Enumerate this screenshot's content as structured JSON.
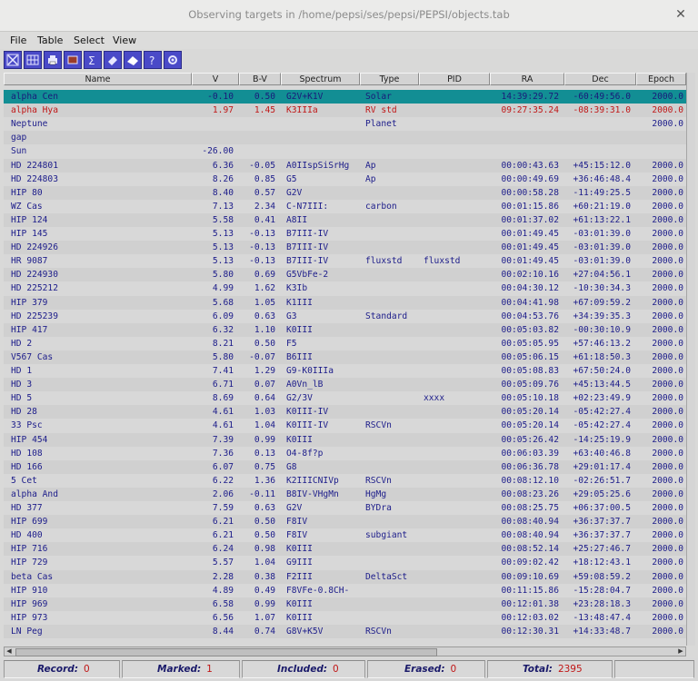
{
  "window": {
    "title": "Observing targets in /home/pepsi/ses/pepsi/PEPSI/objects.tab"
  },
  "menu": [
    "File",
    "Table",
    "Select",
    "View"
  ],
  "toolbar_icons": [
    "select-all-icon",
    "columns-icon",
    "print-icon",
    "cut-icon",
    "sum-icon",
    "tag-icon",
    "erase-icon",
    "help-icon",
    "settings-icon"
  ],
  "colors": {
    "selected_row": "#128e94",
    "text": "#1c1c8a",
    "highlight_red": "#c01616",
    "toolbar_button": "#4a4ac8"
  },
  "columns": [
    "Name",
    "V",
    "B-V",
    "Spectrum",
    "Type",
    "PID",
    "RA",
    "Dec",
    "Epoch"
  ],
  "rows": [
    {
      "name": "alpha Cen",
      "v": "-0.10",
      "bv": "0.50",
      "spectrum": "G2V+K1V",
      "type": "Solar",
      "pid": "",
      "ra": "14:39:29.72",
      "dec": "-60:49:56.0",
      "epoch": "2000.0",
      "state": "selected"
    },
    {
      "name": "alpha Hya",
      "v": "1.97",
      "bv": "1.45",
      "spectrum": "K3IIIa",
      "type": "RV std",
      "pid": "",
      "ra": "09:27:35.24",
      "dec": "-08:39:31.0",
      "epoch": "2000.0",
      "state": "red"
    },
    {
      "name": "Neptune",
      "v": "",
      "bv": "",
      "spectrum": "",
      "type": "Planet",
      "pid": "",
      "ra": "",
      "dec": "",
      "epoch": "2000.0"
    },
    {
      "name": "gap",
      "v": "",
      "bv": "",
      "spectrum": "",
      "type": "",
      "pid": "",
      "ra": "",
      "dec": "",
      "epoch": ""
    },
    {
      "name": "Sun",
      "v": "-26.00",
      "bv": "",
      "spectrum": "",
      "type": "",
      "pid": "",
      "ra": "",
      "dec": "",
      "epoch": ""
    },
    {
      "name": "HD 224801",
      "v": "6.36",
      "bv": "-0.05",
      "spectrum": "A0IIspSiSrHg",
      "type": "Ap",
      "pid": "",
      "ra": "00:00:43.63",
      "dec": "+45:15:12.0",
      "epoch": "2000.0"
    },
    {
      "name": "HD 224803",
      "v": "8.26",
      "bv": "0.85",
      "spectrum": "G5",
      "type": "Ap",
      "pid": "",
      "ra": "00:00:49.69",
      "dec": "+36:46:48.4",
      "epoch": "2000.0"
    },
    {
      "name": "HIP 80",
      "v": "8.40",
      "bv": "0.57",
      "spectrum": "G2V",
      "type": "",
      "pid": "",
      "ra": "00:00:58.28",
      "dec": "-11:49:25.5",
      "epoch": "2000.0"
    },
    {
      "name": "WZ Cas",
      "v": "7.13",
      "bv": "2.34",
      "spectrum": "C-N7III:",
      "type": "carbon",
      "pid": "",
      "ra": "00:01:15.86",
      "dec": "+60:21:19.0",
      "epoch": "2000.0"
    },
    {
      "name": "HIP 124",
      "v": "5.58",
      "bv": "0.41",
      "spectrum": "A8II",
      "type": "",
      "pid": "",
      "ra": "00:01:37.02",
      "dec": "+61:13:22.1",
      "epoch": "2000.0"
    },
    {
      "name": "HIP 145",
      "v": "5.13",
      "bv": "-0.13",
      "spectrum": "B7III-IV",
      "type": "",
      "pid": "",
      "ra": "00:01:49.45",
      "dec": "-03:01:39.0",
      "epoch": "2000.0"
    },
    {
      "name": "HD 224926",
      "v": "5.13",
      "bv": "-0.13",
      "spectrum": "B7III-IV",
      "type": "",
      "pid": "",
      "ra": "00:01:49.45",
      "dec": "-03:01:39.0",
      "epoch": "2000.0"
    },
    {
      "name": "HR 9087",
      "v": "5.13",
      "bv": "-0.13",
      "spectrum": "B7III-IV",
      "type": "fluxstd",
      "pid": "fluxstd",
      "ra": "00:01:49.45",
      "dec": "-03:01:39.0",
      "epoch": "2000.0"
    },
    {
      "name": "HD 224930",
      "v": "5.80",
      "bv": "0.69",
      "spectrum": "G5VbFe-2",
      "type": "",
      "pid": "",
      "ra": "00:02:10.16",
      "dec": "+27:04:56.1",
      "epoch": "2000.0"
    },
    {
      "name": "HD 225212",
      "v": "4.99",
      "bv": "1.62",
      "spectrum": "K3Ib",
      "type": "",
      "pid": "",
      "ra": "00:04:30.12",
      "dec": "-10:30:34.3",
      "epoch": "2000.0"
    },
    {
      "name": "HIP 379",
      "v": "5.68",
      "bv": "1.05",
      "spectrum": "K1III",
      "type": "",
      "pid": "",
      "ra": "00:04:41.98",
      "dec": "+67:09:59.2",
      "epoch": "2000.0"
    },
    {
      "name": "HD 225239",
      "v": "6.09",
      "bv": "0.63",
      "spectrum": "G3",
      "type": "Standard",
      "pid": "",
      "ra": "00:04:53.76",
      "dec": "+34:39:35.3",
      "epoch": "2000.0"
    },
    {
      "name": "HIP 417",
      "v": "6.32",
      "bv": "1.10",
      "spectrum": "K0III",
      "type": "",
      "pid": "",
      "ra": "00:05:03.82",
      "dec": "-00:30:10.9",
      "epoch": "2000.0"
    },
    {
      "name": "HD 2",
      "v": "8.21",
      "bv": "0.50",
      "spectrum": "F5",
      "type": "",
      "pid": "",
      "ra": "00:05:05.95",
      "dec": "+57:46:13.2",
      "epoch": "2000.0"
    },
    {
      "name": "V567 Cas",
      "v": "5.80",
      "bv": "-0.07",
      "spectrum": "B6III",
      "type": "",
      "pid": "",
      "ra": "00:05:06.15",
      "dec": "+61:18:50.3",
      "epoch": "2000.0"
    },
    {
      "name": "HD 1",
      "v": "7.41",
      "bv": "1.29",
      "spectrum": "G9-K0IIIa",
      "type": "",
      "pid": "",
      "ra": "00:05:08.83",
      "dec": "+67:50:24.0",
      "epoch": "2000.0"
    },
    {
      "name": "HD 3",
      "v": "6.71",
      "bv": "0.07",
      "spectrum": "A0Vn_lB",
      "type": "",
      "pid": "",
      "ra": "00:05:09.76",
      "dec": "+45:13:44.5",
      "epoch": "2000.0"
    },
    {
      "name": "HD 5",
      "v": "8.69",
      "bv": "0.64",
      "spectrum": "G2/3V",
      "type": "",
      "pid": "xxxx",
      "ra": "00:05:10.18",
      "dec": "+02:23:49.9",
      "epoch": "2000.0"
    },
    {
      "name": "HD 28",
      "v": "4.61",
      "bv": "1.03",
      "spectrum": "K0III-IV",
      "type": "",
      "pid": "",
      "ra": "00:05:20.14",
      "dec": "-05:42:27.4",
      "epoch": "2000.0"
    },
    {
      "name": "33 Psc",
      "v": "4.61",
      "bv": "1.04",
      "spectrum": "K0III-IV",
      "type": "RSCVn",
      "pid": "",
      "ra": "00:05:20.14",
      "dec": "-05:42:27.4",
      "epoch": "2000.0"
    },
    {
      "name": "HIP 454",
      "v": "7.39",
      "bv": "0.99",
      "spectrum": "K0III",
      "type": "",
      "pid": "",
      "ra": "00:05:26.42",
      "dec": "-14:25:19.9",
      "epoch": "2000.0"
    },
    {
      "name": "HD 108",
      "v": "7.36",
      "bv": "0.13",
      "spectrum": "O4-8f?p",
      "type": "",
      "pid": "",
      "ra": "00:06:03.39",
      "dec": "+63:40:46.8",
      "epoch": "2000.0"
    },
    {
      "name": "HD 166",
      "v": "6.07",
      "bv": "0.75",
      "spectrum": "G8",
      "type": "",
      "pid": "",
      "ra": "00:06:36.78",
      "dec": "+29:01:17.4",
      "epoch": "2000.0"
    },
    {
      "name": "5 Cet",
      "v": "6.22",
      "bv": "1.36",
      "spectrum": "K2IIICNIVp",
      "type": "RSCVn",
      "pid": "",
      "ra": "00:08:12.10",
      "dec": "-02:26:51.7",
      "epoch": "2000.0"
    },
    {
      "name": "alpha And",
      "v": "2.06",
      "bv": "-0.11",
      "spectrum": "B8IV-VHgMn",
      "type": "HgMg",
      "pid": "",
      "ra": "00:08:23.26",
      "dec": "+29:05:25.6",
      "epoch": "2000.0"
    },
    {
      "name": "HD 377",
      "v": "7.59",
      "bv": "0.63",
      "spectrum": "G2V",
      "type": "BYDra",
      "pid": "",
      "ra": "00:08:25.75",
      "dec": "+06:37:00.5",
      "epoch": "2000.0"
    },
    {
      "name": "HIP 699",
      "v": "6.21",
      "bv": "0.50",
      "spectrum": "F8IV",
      "type": "",
      "pid": "",
      "ra": "00:08:40.94",
      "dec": "+36:37:37.7",
      "epoch": "2000.0"
    },
    {
      "name": "HD 400",
      "v": "6.21",
      "bv": "0.50",
      "spectrum": "F8IV",
      "type": "subgiant",
      "pid": "",
      "ra": "00:08:40.94",
      "dec": "+36:37:37.7",
      "epoch": "2000.0"
    },
    {
      "name": "HIP 716",
      "v": "6.24",
      "bv": "0.98",
      "spectrum": "K0III",
      "type": "",
      "pid": "",
      "ra": "00:08:52.14",
      "dec": "+25:27:46.7",
      "epoch": "2000.0"
    },
    {
      "name": "HIP 729",
      "v": "5.57",
      "bv": "1.04",
      "spectrum": "G9III",
      "type": "",
      "pid": "",
      "ra": "00:09:02.42",
      "dec": "+18:12:43.1",
      "epoch": "2000.0"
    },
    {
      "name": "beta Cas",
      "v": "2.28",
      "bv": "0.38",
      "spectrum": "F2III",
      "type": "DeltaSct",
      "pid": "",
      "ra": "00:09:10.69",
      "dec": "+59:08:59.2",
      "epoch": "2000.0"
    },
    {
      "name": "HIP 910",
      "v": "4.89",
      "bv": "0.49",
      "spectrum": "F8VFe-0.8CH-",
      "type": "",
      "pid": "",
      "ra": "00:11:15.86",
      "dec": "-15:28:04.7",
      "epoch": "2000.0"
    },
    {
      "name": "HIP 969",
      "v": "6.58",
      "bv": "0.99",
      "spectrum": "K0III",
      "type": "",
      "pid": "",
      "ra": "00:12:01.38",
      "dec": "+23:28:18.3",
      "epoch": "2000.0"
    },
    {
      "name": "HIP 973",
      "v": "6.56",
      "bv": "1.07",
      "spectrum": "K0III",
      "type": "",
      "pid": "",
      "ra": "00:12:03.02",
      "dec": "-13:48:47.4",
      "epoch": "2000.0"
    },
    {
      "name": "LN Peg",
      "v": "8.44",
      "bv": "0.74",
      "spectrum": "G8V+K5V",
      "type": "RSCVn",
      "pid": "",
      "ra": "00:12:30.31",
      "dec": "+14:33:48.7",
      "epoch": "2000.0"
    }
  ],
  "status": {
    "record_label": "Record:",
    "record": "0",
    "marked_label": "Marked:",
    "marked": "1",
    "included_label": "Included:",
    "included": "0",
    "erased_label": "Erased:",
    "erased": "0",
    "total_label": "Total:",
    "total": "2395"
  }
}
